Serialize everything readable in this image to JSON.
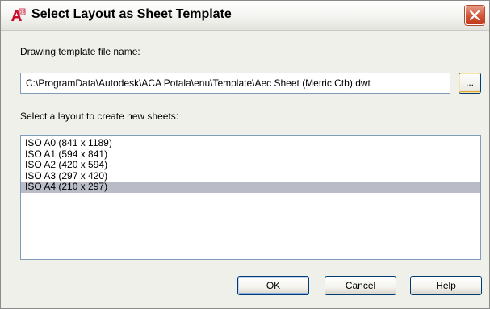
{
  "window": {
    "title": "Select Layout as Sheet Template",
    "icon": "autocad-app-icon",
    "close_icon": "close-icon"
  },
  "template": {
    "label": "Drawing template file name:",
    "path": "C:\\ProgramData\\Autodesk\\ACA Potala\\enu\\Template\\Aec Sheet (Metric Ctb).dwt",
    "browse_label": "..."
  },
  "layouts": {
    "label": "Select a layout to create new sheets:",
    "items": [
      "ISO A0 (841 x 1189)",
      "ISO A1 (594 x 841)",
      "ISO A2 (420 x 594)",
      "ISO A3 (297 x 420)",
      "ISO A4 (210 x 297)"
    ],
    "selected": "ISO A4 (210 x 297)"
  },
  "buttons": {
    "ok": "OK",
    "cancel": "Cancel",
    "help": "Help"
  },
  "colors": {
    "selection": "#b9bcc6",
    "close_button": "#d35a3b",
    "dialog_background": "#f0f0ea"
  }
}
